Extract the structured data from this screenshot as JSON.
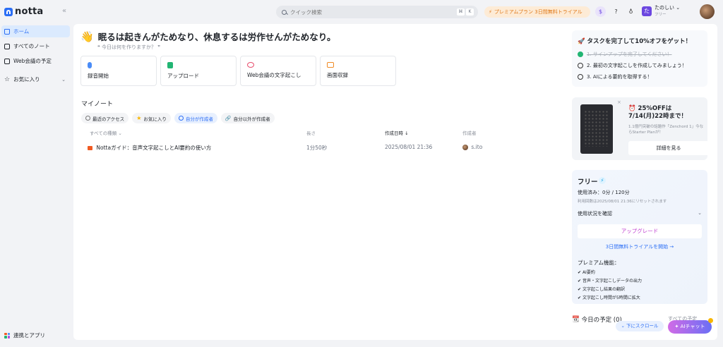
{
  "app": {
    "name": "notta"
  },
  "search": {
    "placeholder": "クイック検索",
    "kbd1": "⌘",
    "kbd2": "K"
  },
  "promo": {
    "label": "プレミアムプラン 3日間無料トライアル"
  },
  "workspace": {
    "badge": "た",
    "name": "たのしい",
    "plan": "フリー"
  },
  "sidebar": {
    "items": [
      {
        "label": "ホーム",
        "icon": "home-icon"
      },
      {
        "label": "すべてのノート",
        "icon": "notes-icon"
      },
      {
        "label": "Web会議の予定",
        "icon": "calendar-icon"
      },
      {
        "label": "お気に入り",
        "icon": "star-icon"
      }
    ],
    "integrations": "連携とアプリ"
  },
  "main": {
    "greeting": "眠るは起きんがためなり、休息するは労作せんがためなり。",
    "quote_prompt": "今日は何を作りますか？",
    "actions": [
      {
        "label": "録音開始",
        "color": "#4a8cf7"
      },
      {
        "label": "アップロード",
        "color": "#22b573"
      },
      {
        "label": "Web会議の文字起こし",
        "color": "#e74c6c"
      },
      {
        "label": "画面収録",
        "color": "#f08a24"
      }
    ],
    "section_title": "マイノート",
    "filters": [
      {
        "label": "最近のアクセス"
      },
      {
        "label": "お気に入り"
      },
      {
        "label": "自分が作成者"
      },
      {
        "label": "自分以外が作成者"
      }
    ],
    "table": {
      "headers": {
        "type": "すべての種類",
        "length": "長さ",
        "created": "作成日時",
        "author": "作成者"
      },
      "rows": [
        {
          "title": "Nottaガイド：音声文字起こしとAI要約の使い方",
          "length": "1分50秒",
          "created": "2025/08/01 21:36",
          "author": "s.ito"
        }
      ]
    }
  },
  "tasks": {
    "title": "🚀 タスクを完了して10%オフをゲット！",
    "items": [
      {
        "label": "1. サインアップを完了してください！",
        "done": true
      },
      {
        "label": "2. 最初の文字起こしを作成してみましょう！",
        "done": false
      },
      {
        "label": "3. AIによる要約を取得する！",
        "done": false
      }
    ]
  },
  "ad": {
    "title": "⏰ 25%OFFは7/14(月)22時まで！",
    "subtitle": "1.1億円突破の話題作「Zenchord 1」今ならStarter Planが！",
    "button": "詳細を見る"
  },
  "plan": {
    "name": "フリー",
    "usage": "使用済み：0分 / 120分",
    "reset": "利用回数は2025/08/01 21:36にリセットされます",
    "check_usage": "使用状況を確認",
    "upgrade": "アップグレード",
    "trial": "3日間無料トライアルを開始 →",
    "premium_title": "プレミアム機能：",
    "features": [
      "AI要約",
      "音声・文字起こしデータの出力",
      "文字起こし結果の翻訳",
      "文字起こし時間が5時間に拡大"
    ]
  },
  "today": {
    "label": "今日の予定 (0)",
    "more": "すべての予定"
  },
  "floating": {
    "scroll": "下にスクロール",
    "ai_chat": "AIチャット"
  }
}
